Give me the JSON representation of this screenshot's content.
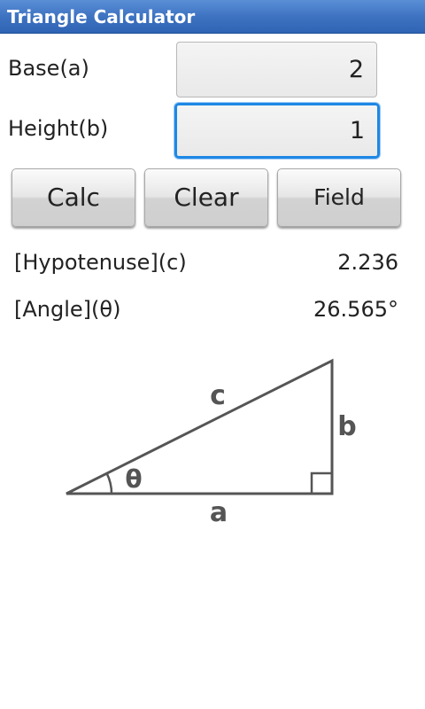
{
  "app": {
    "title": "Triangle Calculator"
  },
  "inputs": {
    "base": {
      "label": "Base(a)",
      "value": "2"
    },
    "height": {
      "label": "Height(b)",
      "value": "1"
    }
  },
  "buttons": {
    "calc": "Calc",
    "clear": "Clear",
    "field": "Field"
  },
  "results": {
    "hypotenuse": {
      "label": "[Hypotenuse](c)",
      "value": "2.236"
    },
    "angle": {
      "label": "[Angle](θ)",
      "value": "26.565°"
    }
  },
  "diagram": {
    "label_c": "c",
    "label_b": "b",
    "label_a": "a",
    "label_theta": "θ"
  },
  "colors": {
    "titlebar": "#3e73c2",
    "focus": "#1e88e5",
    "diagram_stroke": "#555555"
  }
}
